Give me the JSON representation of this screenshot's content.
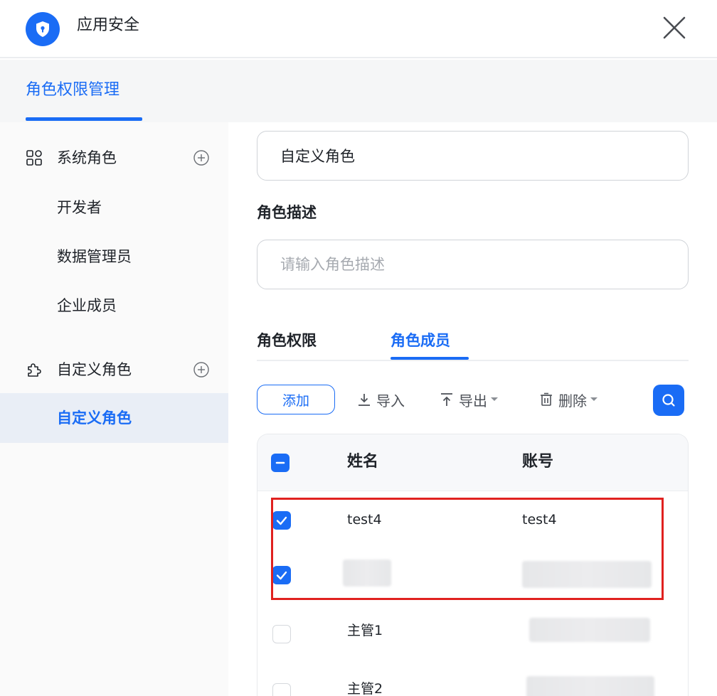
{
  "app": {
    "title": "应用安全",
    "logo_icon": "shield-icon",
    "close_icon": "close-icon"
  },
  "top_tab": {
    "label": "角色权限管理"
  },
  "sidebar": {
    "groups": [
      {
        "label": "系统角色",
        "icon": "grid-apps-icon",
        "add_icon": "plus-circle-icon",
        "items": [
          {
            "label": "开发者"
          },
          {
            "label": "数据管理员"
          },
          {
            "label": "企业成员"
          }
        ]
      },
      {
        "label": "自定义角色",
        "icon": "puzzle-icon",
        "add_icon": "plus-circle-icon",
        "items": [
          {
            "label": "自定义角色",
            "active": true
          }
        ]
      }
    ]
  },
  "form": {
    "role_name_value": "自定义角色",
    "description_label": "角色描述",
    "description_placeholder": "请输入角色描述"
  },
  "tabs": [
    {
      "label": "角色权限",
      "active": false
    },
    {
      "label": "角色成员",
      "active": true
    }
  ],
  "toolbar": {
    "add_label": "添加",
    "import_label": "导入",
    "export_label": "导出",
    "delete_label": "删除",
    "search_icon": "search-icon"
  },
  "table": {
    "columns": [
      "姓名",
      "账号"
    ],
    "header_checkbox": "partial",
    "rows": [
      {
        "name": "test4",
        "account": "test4",
        "checked": true
      },
      {
        "name": "",
        "account": "",
        "checked": true,
        "redacted": true
      },
      {
        "name": "主管1",
        "account": "",
        "checked": false,
        "account_redacted": true
      },
      {
        "name": "主管2",
        "account": "",
        "checked": false,
        "account_redacted": true
      }
    ]
  },
  "colors": {
    "accent": "#1a6cf5",
    "highlight": "#e0211f"
  }
}
